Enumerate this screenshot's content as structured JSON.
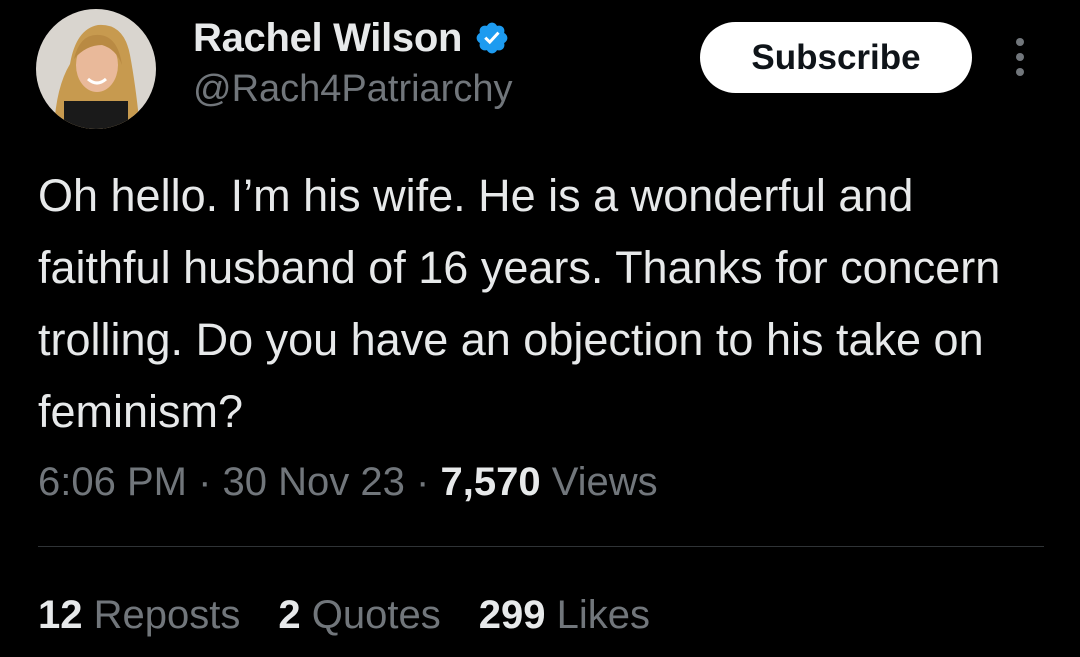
{
  "tweet": {
    "author": {
      "display_name": "Rachel Wilson",
      "handle": "@Rach4Patriarchy",
      "verified_icon": "verified-badge-icon",
      "avatar_icon": "avatar"
    },
    "subscribe_label": "Subscribe",
    "more_icon": "more-vertical-icon",
    "text": "Oh hello. I’m his wife. He is a wonderful and faithful husband of 16 years. Thanks for concern trolling.  Do you have an objection to his take on feminism?",
    "time": "6:06 PM",
    "date": "30 Nov 23",
    "views_count": "7,570",
    "views_label": "Views",
    "separator": "·",
    "stats": {
      "reposts_count": "12",
      "reposts_label": "Reposts",
      "quotes_count": "2",
      "quotes_label": "Quotes",
      "likes_count": "299",
      "likes_label": "Likes"
    }
  },
  "colors": {
    "background": "#000000",
    "primary_text": "#e7e9ea",
    "secondary_text": "#71767b",
    "divider": "#2f3336",
    "verified_blue": "#1d9bf0",
    "button_bg": "#ffffff",
    "button_text": "#0f1419"
  }
}
